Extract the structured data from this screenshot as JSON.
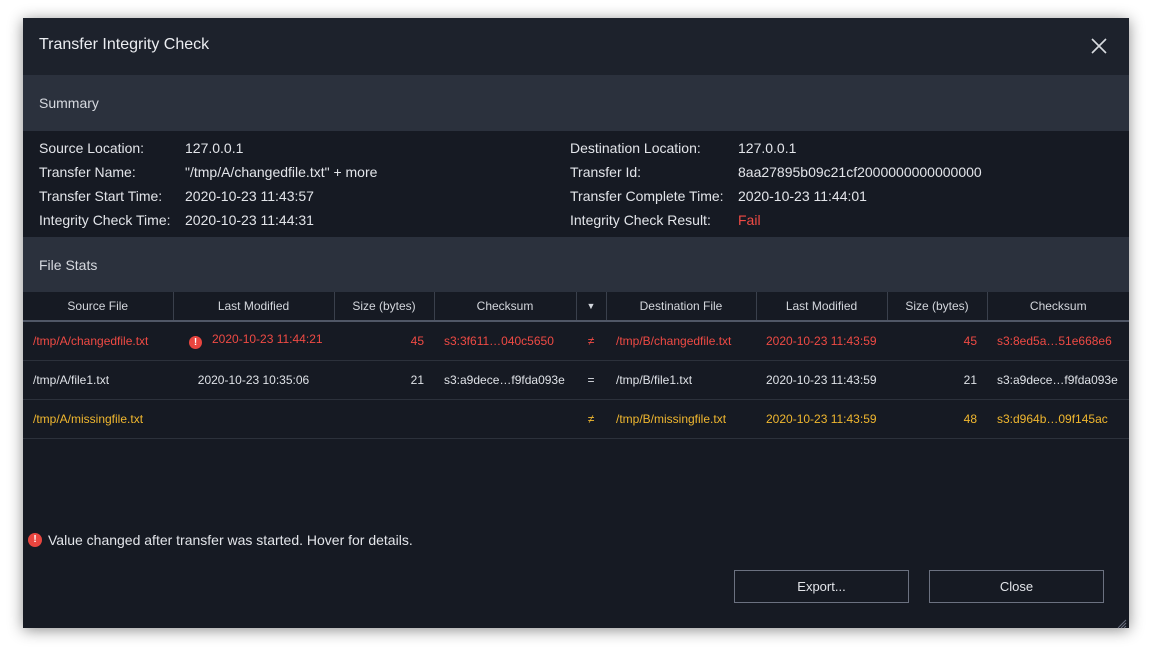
{
  "dialog": {
    "title": "Transfer Integrity Check"
  },
  "summary": {
    "header": "Summary",
    "left": [
      {
        "label": "Source Location:",
        "value": "127.0.0.1"
      },
      {
        "label": "Transfer Name:",
        "value": "\"/tmp/A/changedfile.txt\" + more"
      },
      {
        "label": "Transfer Start Time:",
        "value": "2020-10-23 11:43:57"
      },
      {
        "label": "Integrity Check Time:",
        "value": "2020-10-23 11:44:31"
      }
    ],
    "right": [
      {
        "label": "Destination Location:",
        "value": "127.0.0.1"
      },
      {
        "label": "Transfer Id:",
        "value": "8aa27895b09c21cf2000000000000000"
      },
      {
        "label": "Transfer Complete Time:",
        "value": "2020-10-23 11:44:01"
      },
      {
        "label": "Integrity Check Result:",
        "value": "Fail"
      }
    ]
  },
  "filestats": {
    "header": "File Stats",
    "columns": [
      "Source File",
      "Last Modified",
      "Size (bytes)",
      "Checksum",
      "▼",
      "Destination File",
      "Last Modified",
      "Size (bytes)",
      "Checksum"
    ],
    "rows": [
      {
        "src_file": "/tmp/A/changedfile.txt",
        "src_modified_warn": "!",
        "src_modified": "2020-10-23 11:44:21",
        "src_size": "45",
        "src_checksum": "s3:3f611…040c5650",
        "compare": "≠",
        "dst_file": "/tmp/B/changedfile.txt",
        "dst_modified": "2020-10-23 11:43:59",
        "dst_size": "45",
        "dst_checksum": "s3:8ed5a…51e668e6"
      },
      {
        "src_file": "/tmp/A/file1.txt",
        "src_modified_warn": "",
        "src_modified": "2020-10-23 10:35:06",
        "src_size": "21",
        "src_checksum": "s3:a9dece…f9fda093e",
        "compare": "=",
        "dst_file": "/tmp/B/file1.txt",
        "dst_modified": "2020-10-23 11:43:59",
        "dst_size": "21",
        "dst_checksum": "s3:a9dece…f9fda093e"
      },
      {
        "src_file": "/tmp/A/missingfile.txt",
        "src_modified_warn": "",
        "src_modified": "",
        "src_size": "",
        "src_checksum": "",
        "compare": "≠",
        "dst_file": "/tmp/B/missingfile.txt",
        "dst_modified": "2020-10-23 11:43:59",
        "dst_size": "48",
        "dst_checksum": "s3:d964b…09f145ac"
      }
    ]
  },
  "note": {
    "icon_char": "!",
    "text": "Value changed after transfer was started. Hover for details."
  },
  "buttons": {
    "export": "Export...",
    "close": "Close"
  },
  "colors": {
    "fail": "#ef4a44",
    "missing": "#f0b72f",
    "background": "#161a23",
    "section": "#2b313d"
  }
}
